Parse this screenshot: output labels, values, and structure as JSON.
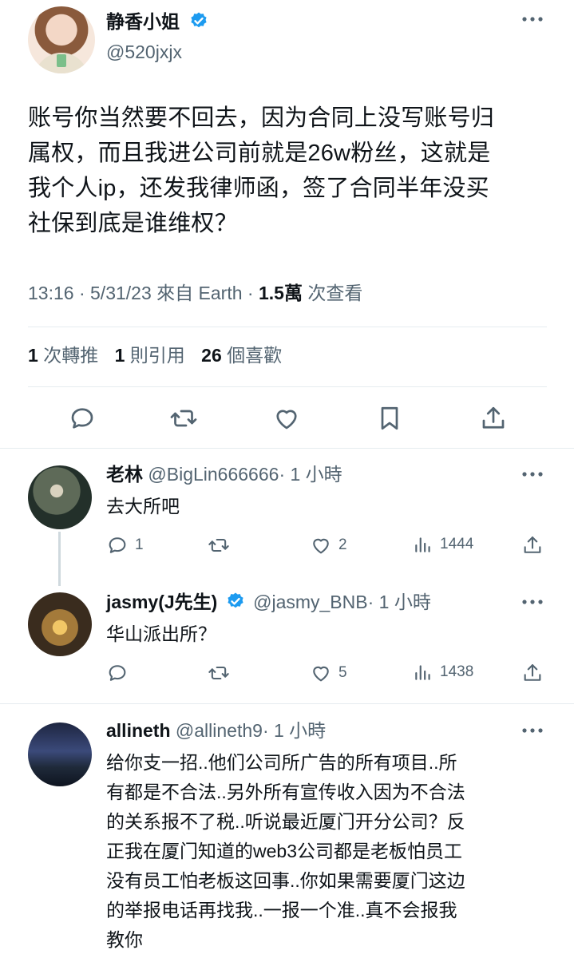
{
  "main_tweet": {
    "display_name": "静香小姐",
    "handle": "@520jxjx",
    "text_lines": [
      "账号你当然要不回去，因为合同上没写账号归",
      "属权，而且我进公司前就是26w粉丝，这就是",
      "我个人ip，还发我律师函，签了合同半年没买",
      "社保到底是谁维权？"
    ],
    "meta": {
      "time": "13:16",
      "date": "5/31/23",
      "source": "來自 Earth",
      "views_count": "1.5萬",
      "views_label": "次查看"
    },
    "stats": {
      "retweets_count": "1",
      "retweets_label": "次轉推",
      "quotes_count": "1",
      "quotes_label": "則引用",
      "likes_count": "26",
      "likes_label": "個喜歡"
    }
  },
  "replies": [
    {
      "display_name": "老林",
      "handle": "@BigLin666666",
      "time": "· 1 小時",
      "text_lines": [
        "去大所吧"
      ],
      "replies_count": "1",
      "likes_count": "2",
      "views_count": "1444"
    },
    {
      "display_name": "jasmy(J先生)",
      "handle": "@jasmy_BNB",
      "time": "· 1 小時",
      "text_lines": [
        "华山派出所？"
      ],
      "likes_count": "5",
      "views_count": "1438"
    },
    {
      "display_name": "allineth",
      "handle": "@allineth9",
      "time": "· 1 小時",
      "text_lines": [
        "给你支一招..他们公司所广告的所有项目..所",
        "有都是不合法..另外所有宣传收入因为不合法",
        "的关系报不了税..听说最近厦门开分公司？反",
        "正我在厦门知道的web3公司都是老板怕员工",
        "没有员工怕老板这回事..你如果需要厦门这边",
        "的举报电话再找我..一报一个准..真不会报我",
        "教你"
      ]
    }
  ],
  "colors": {
    "text": "#0f1419",
    "secondary": "#536471",
    "verified": "#1d9bf0",
    "divider": "#e6ecf0"
  },
  "icons": [
    "verified-badge-icon",
    "more-icon",
    "reply-icon",
    "retweet-icon",
    "like-icon",
    "bookmark-icon",
    "share-icon",
    "views-icon"
  ]
}
